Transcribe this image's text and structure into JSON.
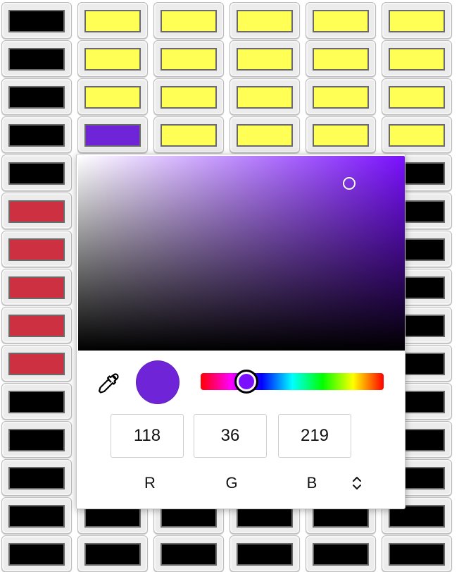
{
  "colors": {
    "black": "#000000",
    "yellow": "#ffff55",
    "red": "#cd3040",
    "purple": "#7024d8"
  },
  "grid": {
    "rows": [
      [
        "black",
        "yellow",
        "yellow",
        "yellow",
        "yellow",
        "yellow"
      ],
      [
        "black",
        "yellow",
        "yellow",
        "yellow",
        "yellow",
        "yellow"
      ],
      [
        "black",
        "yellow",
        "yellow",
        "yellow",
        "yellow",
        "yellow"
      ],
      [
        "black",
        "purple",
        "yellow",
        "yellow",
        "yellow",
        "yellow"
      ],
      [
        "black",
        "black",
        "black",
        "black",
        "black",
        "black"
      ],
      [
        "red",
        "black",
        "black",
        "black",
        "black",
        "black"
      ],
      [
        "red",
        "black",
        "black",
        "black",
        "black",
        "black"
      ],
      [
        "red",
        "black",
        "black",
        "black",
        "black",
        "black"
      ],
      [
        "red",
        "black",
        "black",
        "black",
        "black",
        "black"
      ],
      [
        "red",
        "black",
        "black",
        "black",
        "black",
        "black"
      ],
      [
        "black",
        "black",
        "black",
        "black",
        "black",
        "black"
      ],
      [
        "black",
        "black",
        "black",
        "black",
        "black",
        "black"
      ],
      [
        "black",
        "black",
        "black",
        "black",
        "black",
        "black"
      ],
      [
        "black",
        "black",
        "black",
        "black",
        "black",
        "black"
      ],
      [
        "black",
        "black",
        "black",
        "black",
        "black",
        "black"
      ]
    ]
  },
  "picker": {
    "hue_color": "#7a10ff",
    "saturation": 0.83,
    "brightness": 0.86,
    "hue_fraction": 0.25,
    "selected_color": "#7024d8",
    "icons": {
      "eyedropper": "eyedropper-icon",
      "toggle": "chevron-up-down-icon"
    },
    "r_value": "118",
    "g_value": "36",
    "b_value": "219",
    "r_label": "R",
    "g_label": "G",
    "b_label": "B"
  }
}
